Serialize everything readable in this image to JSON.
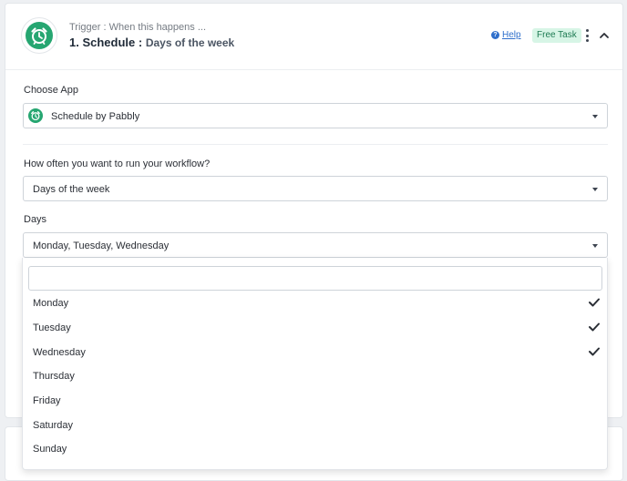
{
  "header": {
    "trigger_label": "Trigger : When this happens ...",
    "step_number": "1. Schedule :",
    "step_event": "Days of the week",
    "help_label": "Help",
    "badge_label": "Free Task"
  },
  "choose_app": {
    "label": "Choose App",
    "value": "Schedule by Pabbly"
  },
  "frequency": {
    "label": "How often you want to run your workflow?",
    "value": "Days of the week"
  },
  "days": {
    "label": "Days",
    "value": "Monday, Tuesday, Wednesday",
    "search_placeholder": "",
    "options": [
      {
        "label": "Monday",
        "selected": true
      },
      {
        "label": "Tuesday",
        "selected": true
      },
      {
        "label": "Wednesday",
        "selected": true
      },
      {
        "label": "Thursday",
        "selected": false
      },
      {
        "label": "Friday",
        "selected": false
      },
      {
        "label": "Saturday",
        "selected": false
      },
      {
        "label": "Sunday",
        "selected": false
      }
    ]
  },
  "colors": {
    "brand_green": "#26a671",
    "link_blue": "#2f6fcb",
    "badge_bg": "#d7f5e6",
    "badge_text": "#1d7a52"
  },
  "icons": {
    "app_logo": "alarm-clock-icon",
    "help": "question-circle-icon",
    "menu": "kebab-menu-icon",
    "collapse": "chevron-up-icon",
    "select_caret": "caret-down-icon",
    "selected": "checkmark-icon"
  }
}
